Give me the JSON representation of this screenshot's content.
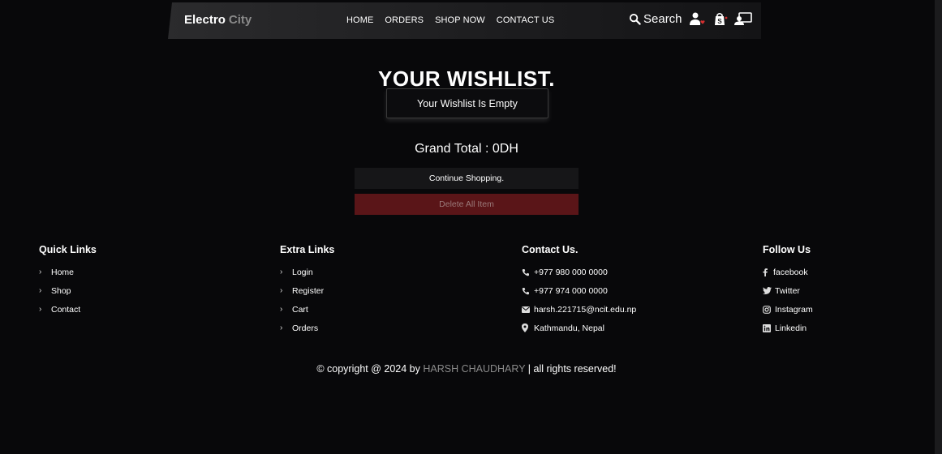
{
  "header": {
    "brand_bold": "Electro",
    "brand_light": "City",
    "nav": [
      "HOME",
      "ORDERS",
      "SHOP NOW",
      "CONTACT US"
    ],
    "search_label": "Search",
    "icons": [
      "search-icon",
      "user-heart-icon",
      "shopping-bag-icon",
      "user-screen-icon"
    ]
  },
  "main": {
    "title": "YOUR WISHLIST.",
    "empty_message": "Your Wishlist Is Empty",
    "grand_total": "Grand Total : 0DH",
    "continue_label": "Continue Shopping.",
    "delete_label": "Delete All Item"
  },
  "footer": {
    "quick_links": {
      "title": "Quick Links",
      "items": [
        "Home",
        "Shop",
        "Contact"
      ]
    },
    "extra_links": {
      "title": "Extra Links",
      "items": [
        "Login",
        "Register",
        "Cart",
        "Orders"
      ]
    },
    "contact": {
      "title": "Contact Us.",
      "items": [
        {
          "icon": "phone-icon",
          "text": "+977 980 000 0000"
        },
        {
          "icon": "phone-icon",
          "text": "+977 974 000 0000"
        },
        {
          "icon": "envelope-icon",
          "text": "harsh.221715@ncit.edu.np"
        },
        {
          "icon": "map-pin-icon",
          "text": "Kathmandu, Nepal"
        }
      ]
    },
    "follow": {
      "title": "Follow Us",
      "items": [
        {
          "icon": "facebook-icon",
          "text": "facebook"
        },
        {
          "icon": "twitter-icon",
          "text": "Twitter"
        },
        {
          "icon": "instagram-icon",
          "text": "Instagram"
        },
        {
          "icon": "linkedin-icon",
          "text": "Linkedin"
        }
      ]
    },
    "copyright_prefix": "© copyright @ 2024 by",
    "copyright_name": "HARSH CHAUDHARY",
    "copyright_suffix": "| all rights reserved!"
  },
  "colors": {
    "background": "#08080a",
    "delete_button": "#5a1518",
    "muted_text": "#8a8a8a"
  }
}
